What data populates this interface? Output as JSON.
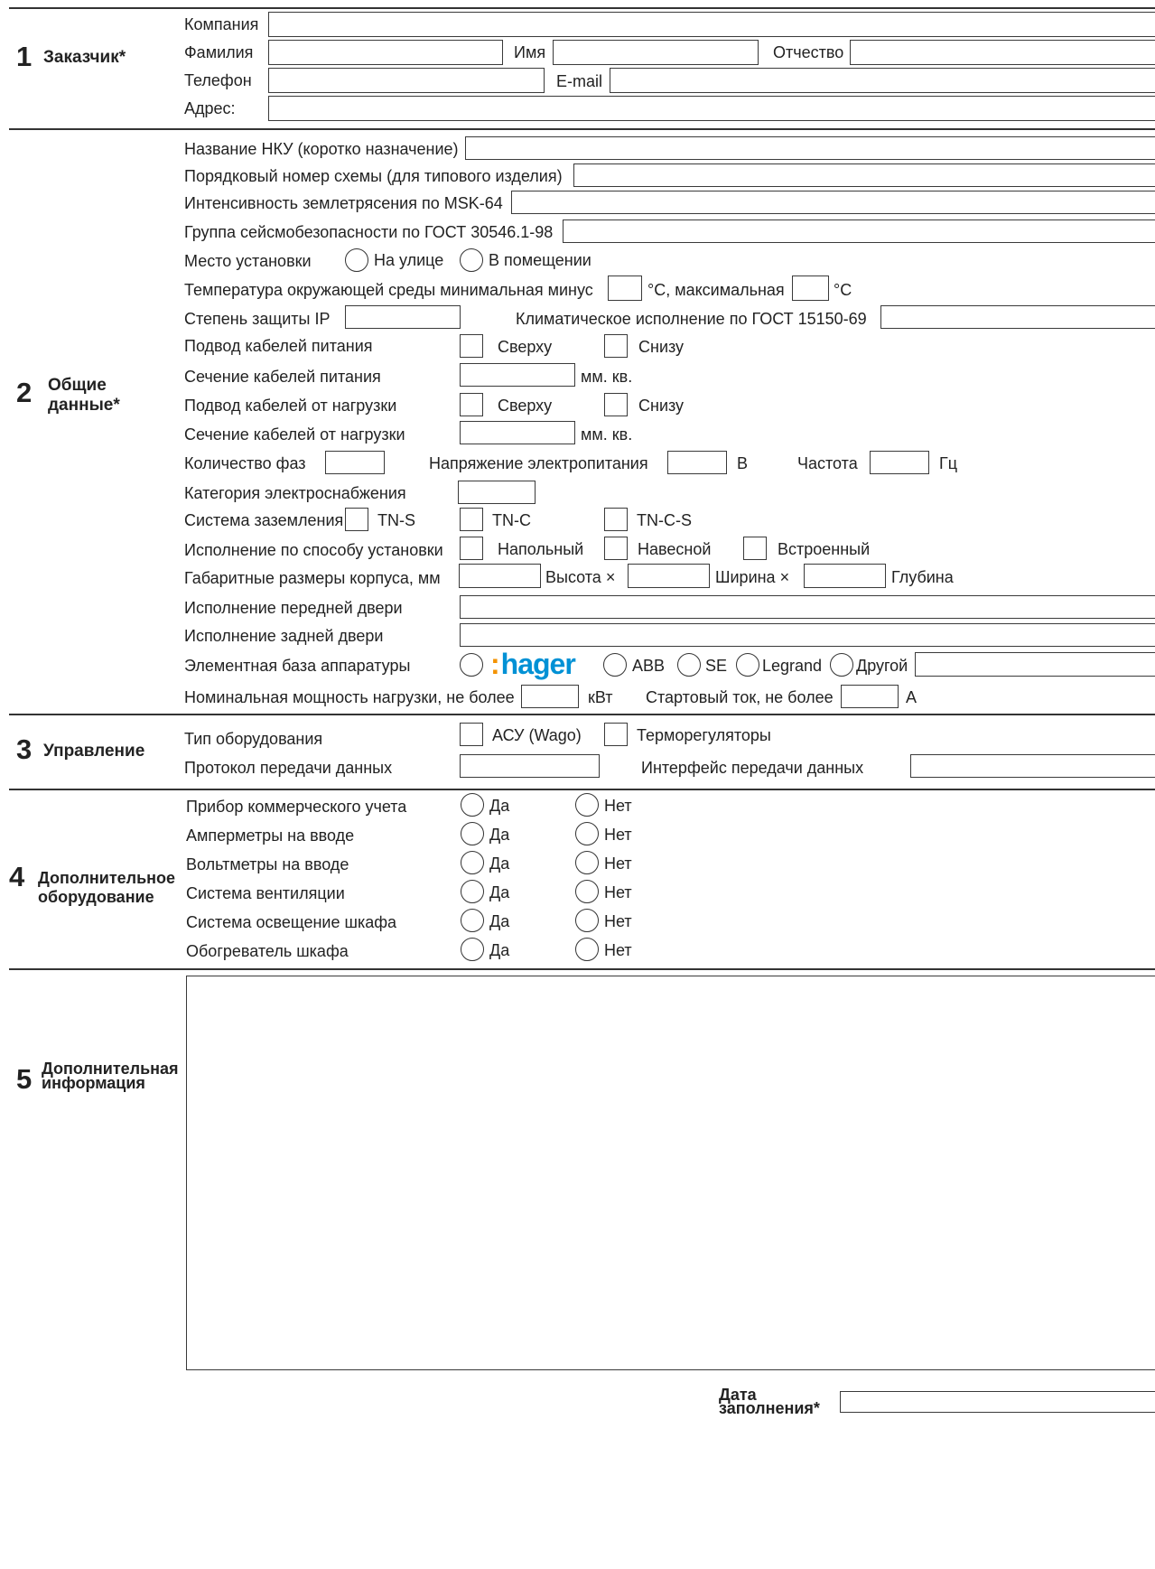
{
  "s1": {
    "num": "1",
    "title": "Заказчик*",
    "company": "Компания",
    "lastname": "Фамилия",
    "firstname": "Имя",
    "patronymic": "Отчество",
    "phone": "Телефон",
    "email": "E-mail",
    "address": "Адрес:"
  },
  "s2": {
    "num": "2",
    "title1": "Общие",
    "title2": "данные*",
    "nku_name": "Название НКУ (коротко назначение)",
    "scheme_no": "Порядковый номер схемы (для типового изделия)",
    "quake": "Интенсивность землетрясения по MSK-64",
    "seismic": "Группа сейсмобезопасности по ГОСТ 30546.1-98",
    "place": "Место установки",
    "outdoor": "На улице",
    "indoor": "В помещении",
    "temp": "Температура окружающей среды минимальная  минус",
    "temp_c1": "°С, максимальная",
    "temp_c2": "°С",
    "ip": "Степень защиты IP",
    "climate": "Климатическое исполнение по ГОСТ 15150-69",
    "power_entry": "Подвод кабелей питания",
    "top": "Сверху",
    "bottom": "Снизу",
    "power_section": "Сечение кабелей питания",
    "sqmm": "мм. кв.",
    "load_entry": "Подвод кабелей от нагрузки",
    "load_section": "Сечение кабелей от нагрузки",
    "phases": "Количество фаз",
    "voltage": "Напряжение электропитания",
    "v_unit": "В",
    "freq": "Частота",
    "hz": "Гц",
    "supply_cat": "Категория электроснабжения",
    "grounding": "Система заземления",
    "tns": "TN-S",
    "tnc": "TN-C",
    "tncs": "TN-C-S",
    "mounting": "Исполнение по способу установки",
    "floor": "Напольный",
    "wall": "Навесной",
    "builtin": "Встроенный",
    "dims": "Габаритные размеры корпуса, мм",
    "height": "Высота  ×",
    "width": "Ширина  ×",
    "depth": "Глубина",
    "front_door": "Исполнение передней двери",
    "rear_door": "Исполнение задней двери",
    "components": "Элементная база аппаратуры",
    "hager_colon": ":",
    "hager": "hager",
    "abb": "ABB",
    "se": "SE",
    "legrand": "Legrand",
    "other": "Другой",
    "power": "Номинальная мощность нагрузки, не более",
    "kw": "кВт",
    "start_current": "Стартовый ток, не более",
    "amp": "А"
  },
  "s3": {
    "num": "3",
    "title": "Управление",
    "equip_type": "Тип оборудования",
    "acs": "АСУ (Wago)",
    "thermo": "Терморегуляторы",
    "protocol": "Протокол передачи данных",
    "interface": "Интерфейс передачи данных"
  },
  "s4": {
    "num": "4",
    "title1": "Дополнительное",
    "title2": "оборудование",
    "yes": "Да",
    "no": "Нет",
    "items": [
      "Прибор коммерческого учета",
      "Амперметры на вводе",
      "Вольтметры на вводе",
      "Система вентиляции",
      "Система освещение шкафа",
      "Обогреватель шкафа"
    ]
  },
  "s5": {
    "num": "5",
    "title1": "Дополнительная",
    "title2": "информация"
  },
  "footer": {
    "date1": "Дата",
    "date2": "заполнения*"
  }
}
